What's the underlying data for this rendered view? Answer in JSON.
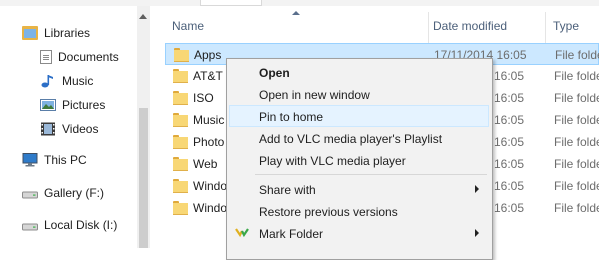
{
  "nav": {
    "items": [
      {
        "label": "Libraries",
        "icon": "libraries-icon"
      },
      {
        "label": "Documents",
        "icon": "documents-icon"
      },
      {
        "label": "Music",
        "icon": "music-icon"
      },
      {
        "label": "Pictures",
        "icon": "pictures-icon"
      },
      {
        "label": "Videos",
        "icon": "videos-icon"
      },
      {
        "label": "This PC",
        "icon": "computer-icon"
      },
      {
        "label": "Gallery (F:)",
        "icon": "drive-icon"
      },
      {
        "label": "Local Disk (I:)",
        "icon": "drive-icon"
      }
    ]
  },
  "columns": {
    "name": "Name",
    "date": "Date modified",
    "type": "Type"
  },
  "rows": [
    {
      "name": "Apps",
      "date": "17/11/2014 16:05",
      "type": "File folder"
    },
    {
      "name": "AT&T",
      "date": "16:05",
      "type": "File folder"
    },
    {
      "name": "ISO",
      "date": "16:05",
      "type": "File folder"
    },
    {
      "name": "Music",
      "date": "16:05",
      "type": "File folder"
    },
    {
      "name": "Photo",
      "date": "16:05",
      "type": "File folder"
    },
    {
      "name": "Web",
      "date": "16:05",
      "type": "File folder"
    },
    {
      "name": "Windo",
      "date": "16:05",
      "type": "File folder"
    },
    {
      "name": "Windo",
      "date": "16:05",
      "type": "File folder"
    }
  ],
  "context_menu": {
    "items": [
      {
        "label": "Open",
        "bold": true
      },
      {
        "label": "Open in new window"
      },
      {
        "label": "Pin to home",
        "highlighted": true
      },
      {
        "label": "Add to VLC media player's Playlist"
      },
      {
        "label": "Play with VLC media player"
      },
      {
        "label": "Share with",
        "submenu": true
      },
      {
        "label": "Restore previous versions"
      },
      {
        "label": "Mark Folder",
        "submenu": true,
        "icon": "mark-folder-icon"
      }
    ]
  },
  "colors": {
    "selection_bg": "#cce8ff",
    "menu_bg": "#f2f2f2",
    "folder": "#f8d775"
  }
}
